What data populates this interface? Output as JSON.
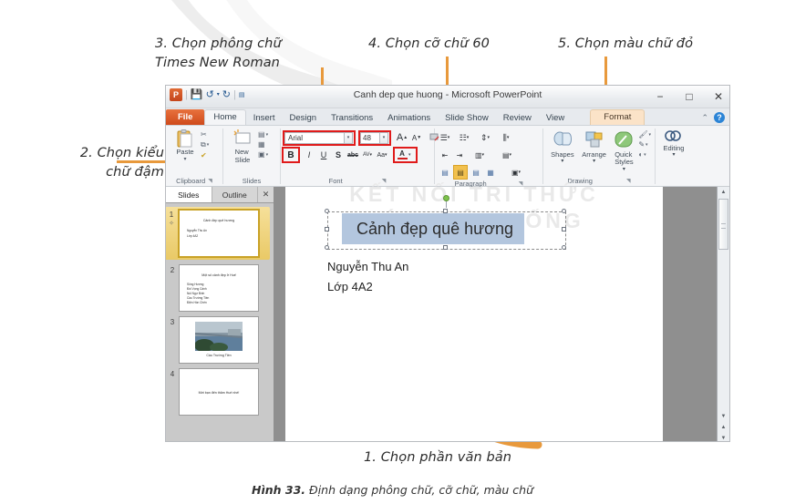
{
  "annotations": {
    "a2": "2. Chọn kiểu\nchữ đậm",
    "a3": "3. Chọn phông chữ\nTimes New Roman",
    "a4": "4. Chọn cỡ chữ 60",
    "a5": "5. Chọn màu chữ đỏ",
    "a1": "1. Chọn phần văn bản",
    "accent_color": "#e8993c",
    "highlight_color": "#e01b1b"
  },
  "figure": {
    "number": "Hình 33.",
    "caption": " Định dạng phông chữ, cỡ chữ, màu chữ"
  },
  "window": {
    "title": "Canh dep que huong  -  Microsoft PowerPoint",
    "logo": "P",
    "quick_access": [
      "save-icon",
      "undo-icon",
      "redo-icon",
      "customize-icon"
    ],
    "controls": {
      "minimize": "−",
      "maximize": "□",
      "close": "✕"
    },
    "help": "?",
    "ribbon_toggle": "⌃"
  },
  "tabs": [
    {
      "label": "File",
      "state": "file"
    },
    {
      "label": "Home",
      "state": "active"
    },
    {
      "label": "Insert",
      "state": ""
    },
    {
      "label": "Design",
      "state": ""
    },
    {
      "label": "Transitions",
      "state": ""
    },
    {
      "label": "Animations",
      "state": ""
    },
    {
      "label": "Slide Show",
      "state": ""
    },
    {
      "label": "Review",
      "state": ""
    },
    {
      "label": "View",
      "state": ""
    },
    {
      "label": "Format",
      "state": "fmt"
    }
  ],
  "ribbon": {
    "clipboard": {
      "group_label": "Clipboard",
      "paste_label": "Paste",
      "items": [
        "cut-icon",
        "copy-icon",
        "format-painter-icon"
      ]
    },
    "slides": {
      "group_label": "Slides",
      "new_slide_label": "New\nSlide",
      "items": [
        "layout-icon",
        "reset-icon",
        "section-icon"
      ]
    },
    "font": {
      "group_label": "Font",
      "font_name": "Arial",
      "font_size": "48",
      "grow_label": "A",
      "shrink_label": "A",
      "clear_formatting": "clear-formatting-icon",
      "bold": "B",
      "italic": "I",
      "underline": "U",
      "shadow": "S",
      "strikethrough": "abc",
      "spacing": "AV",
      "change_case": "Aa",
      "font_color": "A"
    },
    "paragraph": {
      "group_label": "Paragraph",
      "items": [
        "bullets-icon",
        "numbering-icon",
        "line-spacing-icon",
        "text-direction-icon",
        "decrease-indent-icon",
        "increase-indent-icon",
        "columns-icon",
        "align-text-icon",
        "align-left-icon",
        "align-center-icon",
        "align-right-icon",
        "justify-icon",
        "convert-smartart-icon"
      ]
    },
    "drawing": {
      "group_label": "Drawing",
      "shapes_label": "Shapes",
      "arrange_label": "Arrange",
      "quick_styles_label": "Quick\nStyles",
      "items": [
        "shape-fill-icon",
        "shape-outline-icon",
        "shape-effects-icon"
      ]
    },
    "editing": {
      "group_label": "Editing",
      "label": "Editing",
      "icon": "find-icon"
    }
  },
  "slides_pane": {
    "tab_slides": "Slides",
    "tab_outline": "Outline",
    "close": "✕",
    "thumbnails": [
      {
        "number": "1",
        "selected": true,
        "title": "Cảnh đẹp quê hương",
        "lines": [
          "Nguyễn Thu An",
          "Lớp 4A2"
        ]
      },
      {
        "number": "2",
        "selected": false,
        "title": "Một số cảnh đẹp ở Huế",
        "lines": [
          "Sông Hương",
          "Đồi Vọng Cảnh",
          "Núi Ngự Bình",
          "Cầu Trường Tiền",
          "Điện Hòn Chén"
        ]
      },
      {
        "number": "3",
        "selected": false,
        "title": "",
        "caption": "Cầu Trường Tiền",
        "has_image": true
      },
      {
        "number": "4",
        "selected": false,
        "title": "",
        "lines": [
          "Mời bạn đến thăm Huế nhé!"
        ]
      }
    ]
  },
  "slide_editor": {
    "watermark": "KẾT NỐI TRI THỨC\nVỚI CUỘC SỐNG",
    "title_text": "Cảnh đẹp quê hương",
    "title_selected": true,
    "body_lines": [
      "Nguyễn Thu An",
      "Lớp 4A2"
    ],
    "scrollbar": {
      "up": "▲",
      "down": "▼",
      "prev_slide": "▲",
      "next_slide": "▼"
    }
  }
}
